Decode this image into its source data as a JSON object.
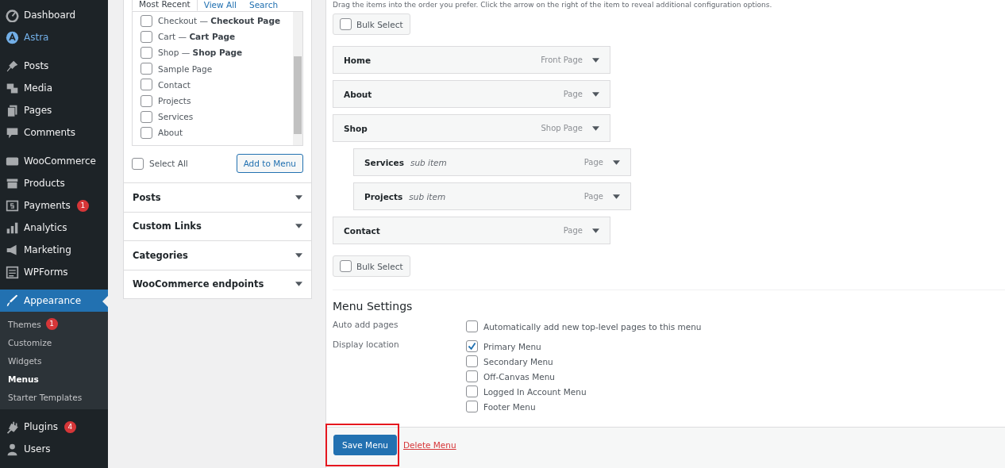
{
  "sidebar": {
    "items": [
      {
        "label": "Dashboard",
        "selected": false
      },
      {
        "label": "Astra",
        "selected": false
      },
      {
        "label": "Posts",
        "selected": false
      },
      {
        "label": "Media",
        "selected": false
      },
      {
        "label": "Pages",
        "selected": false
      },
      {
        "label": "Comments",
        "selected": false
      },
      {
        "label": "WooCommerce",
        "selected": false
      },
      {
        "label": "Products",
        "selected": false
      },
      {
        "label": "Payments",
        "selected": false,
        "badge": "1"
      },
      {
        "label": "Analytics",
        "selected": false
      },
      {
        "label": "Marketing",
        "selected": false
      },
      {
        "label": "WPForms",
        "selected": false
      },
      {
        "label": "Appearance",
        "selected": true,
        "children": [
          {
            "label": "Themes",
            "selected": false,
            "badge": "1"
          },
          {
            "label": "Customize",
            "selected": false
          },
          {
            "label": "Widgets",
            "selected": false
          },
          {
            "label": "Menus",
            "selected": true
          },
          {
            "label": "Starter Templates",
            "selected": false
          }
        ]
      },
      {
        "label": "Plugins",
        "selected": false,
        "badge": "4"
      },
      {
        "label": "Users",
        "selected": false
      }
    ]
  },
  "add_items": {
    "tabs": [
      {
        "label": "Most Recent",
        "selected": true
      },
      {
        "label": "View All",
        "selected": false
      },
      {
        "label": "Search",
        "selected": false
      }
    ],
    "pages": [
      {
        "label": "Checkout — **Checkout Page**",
        "checked": false
      },
      {
        "label": "Cart — **Cart Page**",
        "checked": false
      },
      {
        "label": "Shop — **Shop Page**",
        "checked": false
      },
      {
        "label": "Sample Page",
        "checked": false
      },
      {
        "label": "Contact",
        "checked": false
      },
      {
        "label": "Projects",
        "checked": false
      },
      {
        "label": "Services",
        "checked": false
      },
      {
        "label": "About",
        "checked": false
      }
    ],
    "select_all": {
      "label": "Select All",
      "checked": false
    },
    "add_button": "Add to Menu",
    "sections": [
      {
        "label": "Posts",
        "expanded": false
      },
      {
        "label": "Custom Links",
        "expanded": false
      },
      {
        "label": "Categories",
        "expanded": false
      },
      {
        "label": "WooCommerce endpoints",
        "expanded": false
      }
    ]
  },
  "menu_structure": {
    "instructions": "Drag the items into the order you prefer. Click the arrow on the right of the item to reveal additional configuration options.",
    "bulk_select_top": {
      "label": "Bulk Select",
      "checked": false
    },
    "items": [
      {
        "title": "Home",
        "type": "Front Page"
      },
      {
        "title": "About",
        "type": "Page"
      },
      {
        "title": "Shop",
        "type": "Shop Page",
        "children": [
          {
            "title": "Services",
            "note": "sub item",
            "type": "Page"
          },
          {
            "title": "Projects",
            "note": "sub item",
            "type": "Page"
          }
        ]
      },
      {
        "title": "Contact",
        "type": "Page"
      }
    ],
    "bulk_select_bottom": {
      "label": "Bulk Select",
      "checked": false
    }
  },
  "menu_settings": {
    "title": "Menu Settings",
    "rows": [
      {
        "label": "Auto add pages",
        "options": [
          {
            "label": "Automatically add new top-level pages to this menu",
            "checked": false
          }
        ]
      },
      {
        "label": "Display location",
        "options": [
          {
            "label": "Primary Menu",
            "checked": true
          },
          {
            "label": "Secondary Menu",
            "checked": false
          },
          {
            "label": "Off-Canvas Menu",
            "checked": false
          },
          {
            "label": "Logged In Account Menu",
            "checked": false
          },
          {
            "label": "Footer Menu",
            "checked": false
          }
        ]
      }
    ]
  },
  "footer": {
    "save_button": {
      "label": "Save Menu",
      "highlighted": true
    },
    "delete_link": "Delete Menu"
  }
}
